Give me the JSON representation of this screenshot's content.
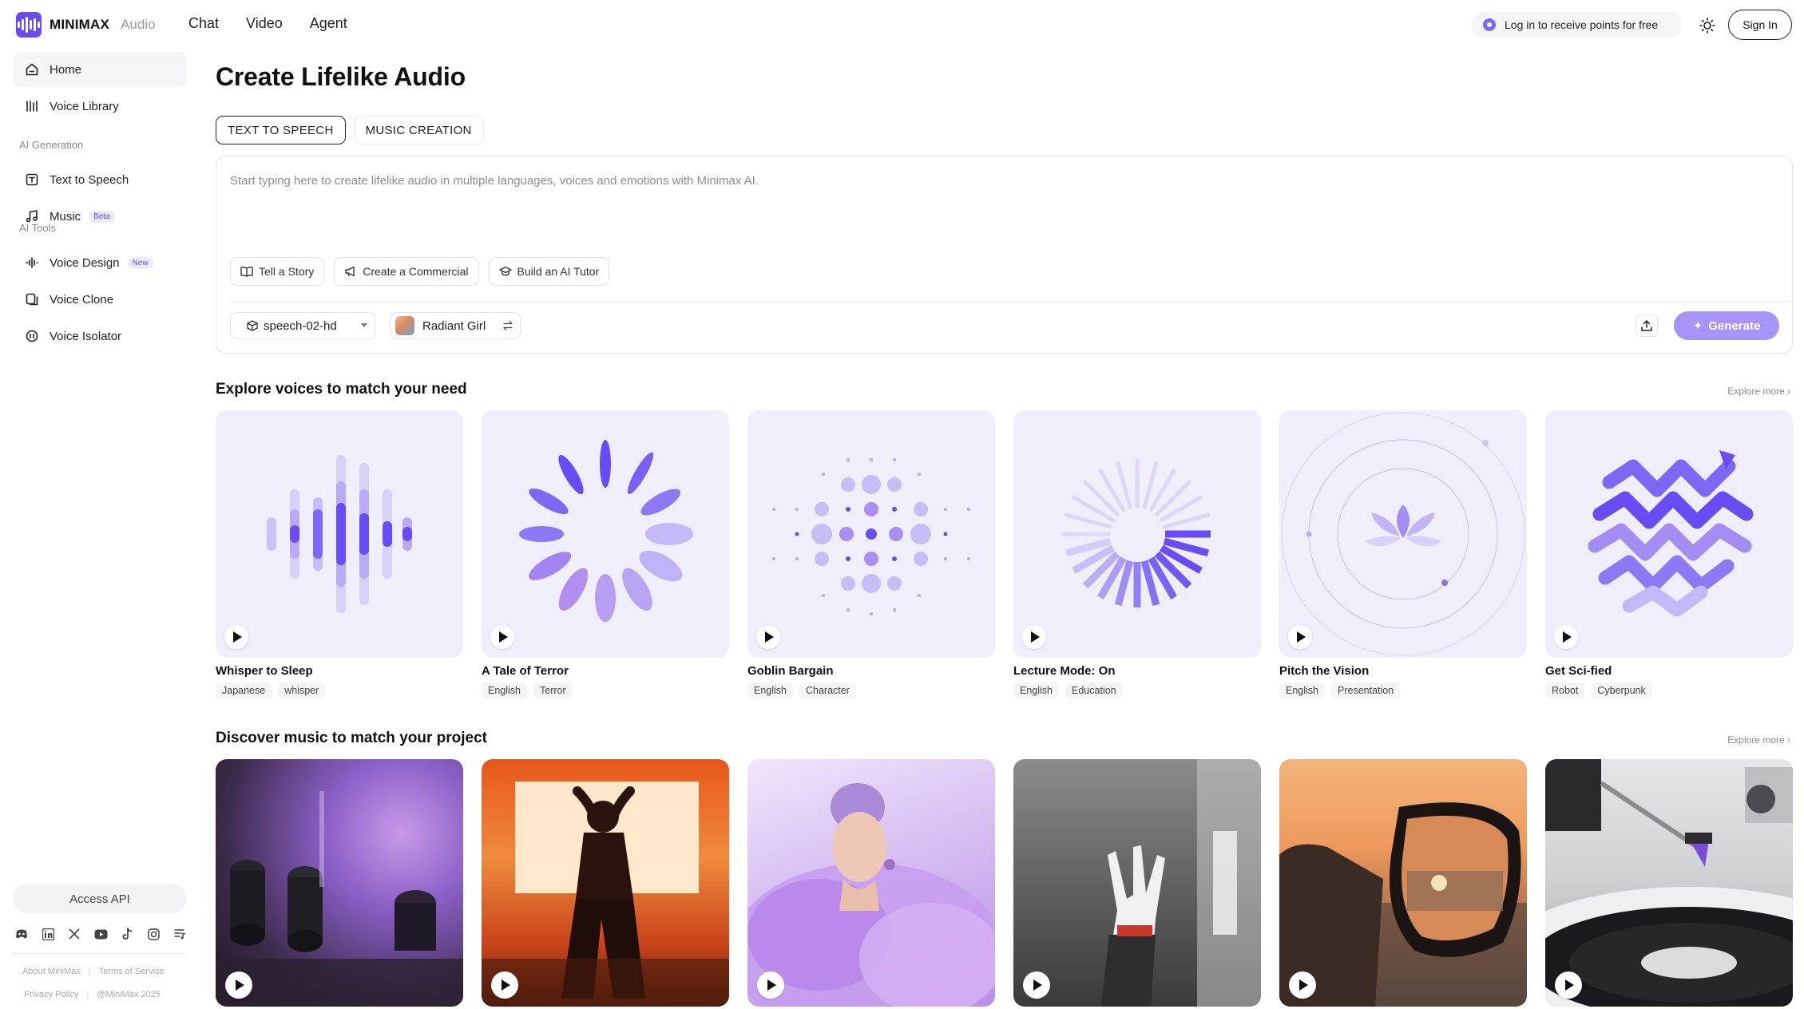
{
  "header": {
    "brand": "MINIMAX",
    "product": "Audio",
    "nav": [
      "Chat",
      "Video",
      "Agent"
    ],
    "promo_text": "Log in to receive points for free",
    "sign_in": "Sign In"
  },
  "sidebar": {
    "items": [
      {
        "label": "Home",
        "icon": "home-icon"
      },
      {
        "label": "Voice Library",
        "icon": "library-icon"
      }
    ],
    "section_ai_generation": "AI Generation",
    "generation_items": [
      {
        "label": "Text to Speech",
        "icon": "text-to-speech-icon"
      },
      {
        "label": "Music",
        "icon": "music-note-icon",
        "tag": "Beta"
      }
    ],
    "section_ai_tools": "AI Tools",
    "tool_items": [
      {
        "label": "Voice Design",
        "icon": "voice-design-icon",
        "tag": "New"
      },
      {
        "label": "Voice Clone",
        "icon": "voice-clone-icon"
      },
      {
        "label": "Voice Isolator",
        "icon": "voice-isolator-icon"
      }
    ],
    "access_api": "Access API",
    "socials": [
      "discord-icon",
      "linkedin-icon",
      "x-icon",
      "youtube-icon",
      "tiktok-icon",
      "instagram-icon",
      "playlist-icon"
    ],
    "footer": {
      "about": "About MiniMax",
      "terms": "Terms of Service",
      "privacy": "Privacy Policy",
      "copyright": "@MiniMax 2025"
    }
  },
  "main": {
    "title": "Create Lifelike Audio",
    "tabs": [
      "TEXT TO SPEECH",
      "MUSIC CREATION"
    ],
    "editor": {
      "placeholder": "Start typing here to create lifelike audio in multiple languages, voices and emotions with Minimax AI.",
      "chips": [
        "Tell a Story",
        "Create a Commercial",
        "Build an AI Tutor"
      ],
      "model": "speech-02-hd",
      "voice": "Radiant Girl",
      "generate": "Generate"
    },
    "voices_section": {
      "title": "Explore voices to match your need",
      "explore_more": "Explore more ›",
      "cards": [
        {
          "title": "Whisper to Sleep",
          "tags": [
            "Japanese",
            "whisper"
          ]
        },
        {
          "title": "A Tale of Terror",
          "tags": [
            "English",
            "Terror"
          ]
        },
        {
          "title": "Goblin Bargain",
          "tags": [
            "English",
            "Character"
          ]
        },
        {
          "title": "Lecture Mode: On",
          "tags": [
            "English",
            "Education"
          ]
        },
        {
          "title": "Pitch the Vision",
          "tags": [
            "English",
            "Presentation"
          ]
        },
        {
          "title": "Get Sci-fied",
          "tags": [
            "Robot",
            "Cyberpunk"
          ]
        }
      ]
    },
    "music_section": {
      "title": "Discover music to match your project",
      "explore_more": "Explore more ›"
    }
  },
  "colors": {
    "accent": "#6a4cf4",
    "generate_bg": "#a794f8",
    "card_bg": "#f1eefb"
  }
}
